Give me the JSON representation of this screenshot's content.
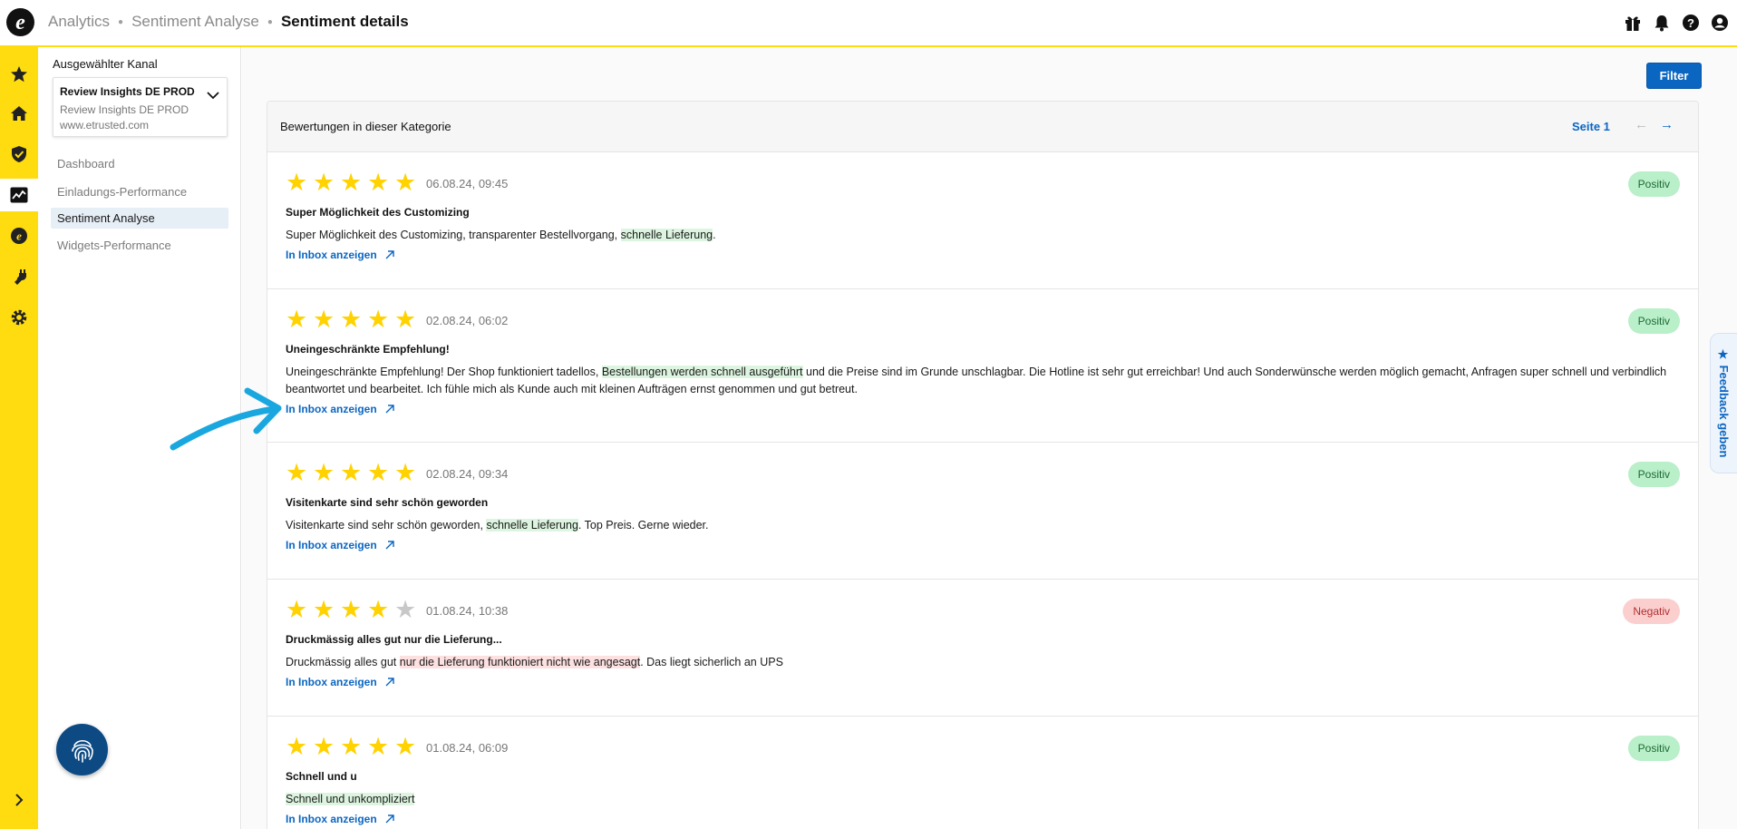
{
  "header": {
    "logo_letter": "e",
    "breadcrumbs": [
      "Analytics",
      "Sentiment Analyse"
    ],
    "current": "Sentiment details",
    "icons": [
      "gift-icon",
      "bell-icon",
      "help-icon",
      "user-icon"
    ]
  },
  "rail": {
    "items": [
      "star-icon",
      "home-icon",
      "shield-check-icon",
      "analytics-chart-icon",
      "etrusted-coin-icon",
      "plug-icon",
      "gear-icon"
    ],
    "expand_icon": "chevron-right-icon"
  },
  "sidebar": {
    "title": "Ausgewählter Kanal",
    "channel": {
      "name": "Review Insights DE PROD",
      "subtitle": "Review Insights DE PROD",
      "url": "www.etrusted.com"
    },
    "nav": [
      {
        "label": "Dashboard",
        "active": false
      },
      {
        "label": "Einladungs-Performance",
        "active": false
      },
      {
        "label": "Sentiment Analyse",
        "active": true
      },
      {
        "label": "Widgets-Performance",
        "active": false
      }
    ]
  },
  "main": {
    "filter_label": "Filter",
    "card_title": "Bewertungen in dieser Kategorie",
    "page_label": "Seite 1",
    "prev_arrow": "←",
    "next_arrow": "→",
    "inbox_label": "In Inbox anzeigen",
    "reviews": [
      {
        "rating": 5,
        "date": "06.08.24, 09:45",
        "title": "Super Möglichkeit des Customizing",
        "text_before": "Super Möglichkeit des Customizing, transparenter Bestellvorgang, ",
        "highlight": "schnelle Lieferung",
        "text_after": ".",
        "sentiment": "Positiv"
      },
      {
        "rating": 5,
        "date": "02.08.24, 06:02",
        "title": "Uneingeschränkte Empfehlung!",
        "text_before": "Uneingeschränkte Empfehlung! Der Shop funktioniert tadellos, ",
        "highlight": "Bestellungen werden schnell ausgeführt",
        "text_after": "  und die Preise sind im Grunde unschlagbar. Die Hotline ist sehr gut erreichbar! Und auch Sonderwünsche werden möglich gemacht, Anfragen super schnell und verbindlich beantwortet und bearbeitet. Ich fühle mich als Kunde auch mit kleinen Aufträgen ernst genommen und gut betreut.",
        "sentiment": "Positiv"
      },
      {
        "rating": 5,
        "date": "02.08.24, 09:34",
        "title": "Visitenkarte sind sehr schön geworden",
        "text_before": "Visitenkarte sind sehr schön geworden, ",
        "highlight": "schnelle Lieferung",
        "text_after": ". Top Preis. Gerne wieder.",
        "sentiment": "Positiv"
      },
      {
        "rating": 4,
        "date": "01.08.24, 10:38",
        "title": "Druckmässig alles gut nur die Lieferung...",
        "text_before": "Druckmässig alles gut ",
        "highlight": "nur die Lieferung funktioniert nicht wie angesagt",
        "text_after": ". Das liegt sicherlich an UPS",
        "sentiment": "Negativ"
      },
      {
        "rating": 5,
        "date": "01.08.24, 06:09",
        "title": "Schnell und u",
        "text_before": "",
        "highlight": "Schnell und unkompliziert",
        "text_after": "",
        "sentiment": "Positiv"
      }
    ]
  },
  "feedback_tab": "★ Feedback geben",
  "colors": {
    "brand_yellow": "#ffdc0f",
    "link_blue": "#0b66c2",
    "positive_bg": "#b9efc9",
    "negative_bg": "#fccfcf",
    "annotation_arrow": "#1aa7e0"
  }
}
